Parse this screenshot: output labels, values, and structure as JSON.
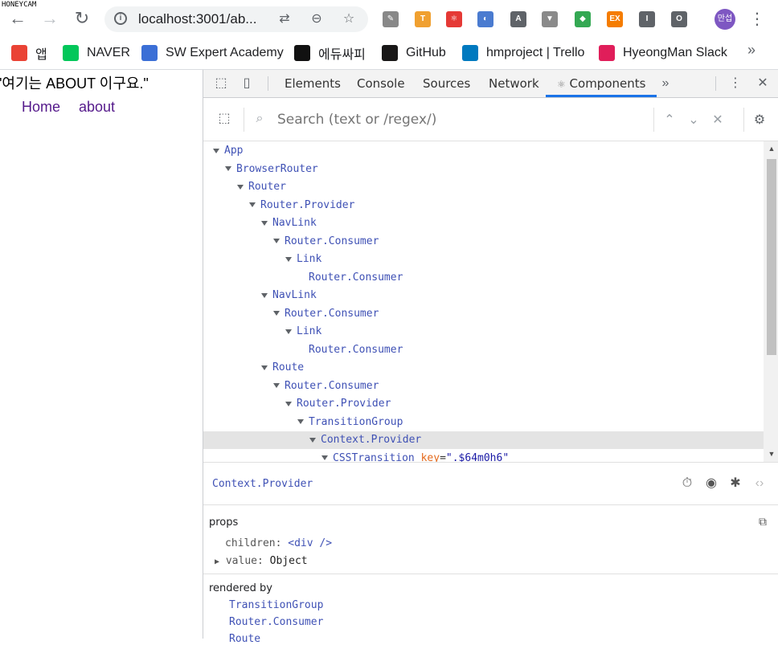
{
  "browser": {
    "url": "localhost:3001/ab...",
    "profile_label": "만섭",
    "bookmarks": [
      {
        "label": "앱",
        "icon": "apps-grid-icon",
        "color": "#ea4335"
      },
      {
        "label": "NAVER",
        "icon": "naver-icon",
        "color": "#03c75a"
      },
      {
        "label": "SW Expert Academy",
        "icon": "swea-icon",
        "color": "#3b6fd6"
      },
      {
        "label": "에듀싸피",
        "icon": "edussafy-icon",
        "color": "#111111"
      },
      {
        "label": "GitHub",
        "icon": "github-icon",
        "color": "#181717"
      },
      {
        "label": "hmproject | Trello",
        "icon": "trello-icon",
        "color": "#0079bf"
      },
      {
        "label": "HyeongMan Slack",
        "icon": "slack-icon",
        "color": "#e01e5a"
      }
    ],
    "extensions": [
      {
        "name": "eyedropper-icon",
        "glyph": "✎",
        "color": "#888888"
      },
      {
        "name": "extension-t-icon",
        "glyph": "T",
        "color": "#f0a030"
      },
      {
        "name": "react-devtools-icon",
        "glyph": "⚛",
        "color": "#e53935"
      },
      {
        "name": "circle-ext-icon",
        "glyph": "◐",
        "color": "#4a7bd0"
      },
      {
        "name": "a-ext-icon",
        "glyph": "A",
        "color": "#5f6368"
      },
      {
        "name": "vue-devtools-icon",
        "glyph": "▼",
        "color": "#8a8a8a"
      },
      {
        "name": "green-ext-icon",
        "glyph": "◆",
        "color": "#34a853"
      },
      {
        "name": "ex-ext-icon",
        "glyph": "EX",
        "color": "#f57c00"
      },
      {
        "name": "i-ext-icon",
        "glyph": "I",
        "color": "#5f6368"
      },
      {
        "name": "o-ext-icon",
        "glyph": "O",
        "color": "#5f6368"
      }
    ]
  },
  "watermark": "HONEYCAM",
  "page": {
    "text": "\"여기는 ABOUT 이구요.\"",
    "links": [
      "Home",
      "about"
    ]
  },
  "devtools": {
    "tabs": [
      "Elements",
      "Console",
      "Sources",
      "Network",
      "Components"
    ],
    "active_tab": "Components",
    "search_placeholder": "Search (text or /regex/)",
    "tree": [
      {
        "label": "App",
        "depth": 0,
        "expanded": true
      },
      {
        "label": "BrowserRouter",
        "depth": 1,
        "expanded": true
      },
      {
        "label": "Router",
        "depth": 2,
        "expanded": true
      },
      {
        "label": "Router.Provider",
        "depth": 3,
        "expanded": true
      },
      {
        "label": "NavLink",
        "depth": 4,
        "expanded": true
      },
      {
        "label": "Router.Consumer",
        "depth": 5,
        "expanded": true
      },
      {
        "label": "Link",
        "depth": 6,
        "expanded": true
      },
      {
        "label": "Router.Consumer",
        "depth": 7,
        "expanded": false
      },
      {
        "label": "NavLink",
        "depth": 4,
        "expanded": true
      },
      {
        "label": "Router.Consumer",
        "depth": 5,
        "expanded": true
      },
      {
        "label": "Link",
        "depth": 6,
        "expanded": true
      },
      {
        "label": "Router.Consumer",
        "depth": 7,
        "expanded": false
      },
      {
        "label": "Route",
        "depth": 4,
        "expanded": true
      },
      {
        "label": "Router.Consumer",
        "depth": 5,
        "expanded": true
      },
      {
        "label": "Router.Provider",
        "depth": 6,
        "expanded": true
      },
      {
        "label": "TransitionGroup",
        "depth": 7,
        "expanded": true
      },
      {
        "label": "Context.Provider",
        "depth": 8,
        "expanded": true,
        "selected": true
      },
      {
        "label": "CSSTransition",
        "depth": 9,
        "expanded": true,
        "key": "\".$64m0h6\""
      }
    ],
    "selected_component": "Context.Provider",
    "props_label": "props",
    "props": [
      {
        "key": "children:",
        "value": "<div />",
        "kind": "jsx"
      },
      {
        "key": "value:",
        "value": "Object",
        "kind": "object"
      }
    ],
    "rendered_by_label": "rendered by",
    "rendered_by": [
      "TransitionGroup",
      "Router.Consumer",
      "Route"
    ]
  }
}
